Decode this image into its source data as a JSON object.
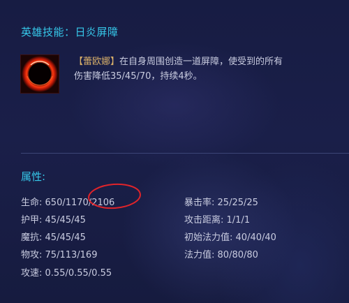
{
  "skill": {
    "title": "英雄技能：日炎屏障",
    "icon": "solar-eclipse-icon",
    "champion_tag": "【蕾欧娜】",
    "description_line1": "在自身周围创造一道屏障，使受到的所有",
    "description_line2": "伤害降低35/45/70，持续4秒。"
  },
  "attributes": {
    "title": "属性:",
    "left": [
      {
        "label": "生命",
        "value": "650/1170/2106"
      },
      {
        "label": "护甲",
        "value": "45/45/45"
      },
      {
        "label": "魔抗",
        "value": "45/45/45"
      },
      {
        "label": "物攻",
        "value": "75/113/169"
      },
      {
        "label": "攻速",
        "value": "0.55/0.55/0.55"
      }
    ],
    "right": [
      {
        "label": "暴击率",
        "value": "25/25/25"
      },
      {
        "label": "攻击距离",
        "value": "1/1/1"
      },
      {
        "label": "初始法力值",
        "value": "40/40/40"
      },
      {
        "label": "法力值",
        "value": "80/80/80"
      }
    ],
    "separator": ": "
  },
  "annotation": {
    "color": "#e0242a"
  }
}
